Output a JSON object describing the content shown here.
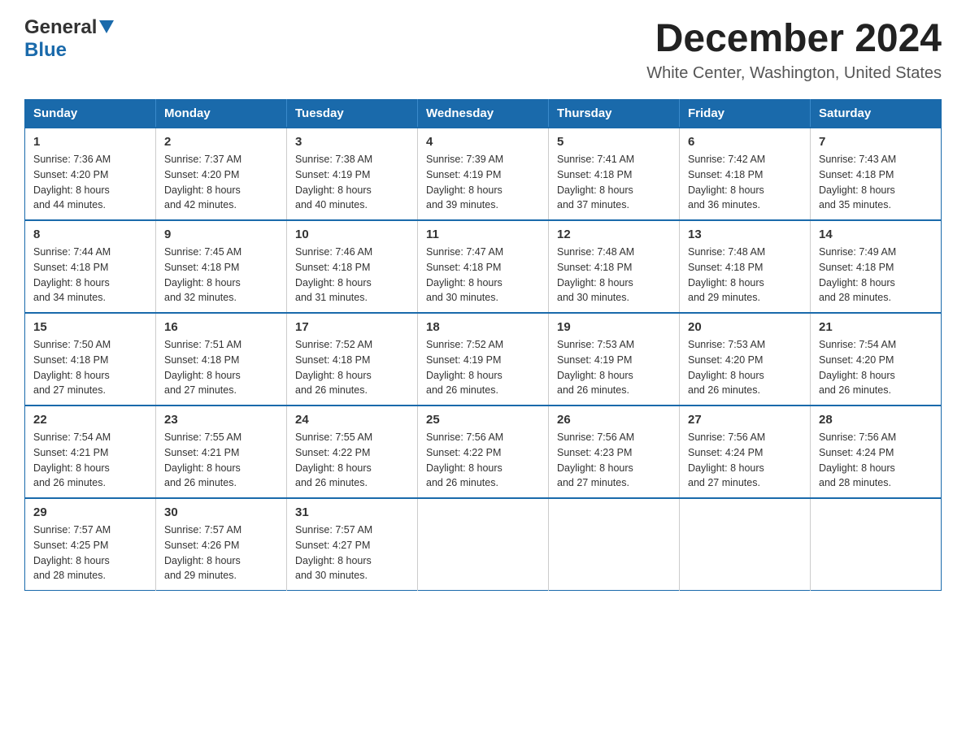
{
  "header": {
    "logo_general": "General",
    "logo_blue": "Blue",
    "month_title": "December 2024",
    "location": "White Center, Washington, United States"
  },
  "days_of_week": [
    "Sunday",
    "Monday",
    "Tuesday",
    "Wednesday",
    "Thursday",
    "Friday",
    "Saturday"
  ],
  "weeks": [
    [
      {
        "day": "1",
        "sunrise": "7:36 AM",
        "sunset": "4:20 PM",
        "daylight": "8 hours and 44 minutes."
      },
      {
        "day": "2",
        "sunrise": "7:37 AM",
        "sunset": "4:20 PM",
        "daylight": "8 hours and 42 minutes."
      },
      {
        "day": "3",
        "sunrise": "7:38 AM",
        "sunset": "4:19 PM",
        "daylight": "8 hours and 40 minutes."
      },
      {
        "day": "4",
        "sunrise": "7:39 AM",
        "sunset": "4:19 PM",
        "daylight": "8 hours and 39 minutes."
      },
      {
        "day": "5",
        "sunrise": "7:41 AM",
        "sunset": "4:18 PM",
        "daylight": "8 hours and 37 minutes."
      },
      {
        "day": "6",
        "sunrise": "7:42 AM",
        "sunset": "4:18 PM",
        "daylight": "8 hours and 36 minutes."
      },
      {
        "day": "7",
        "sunrise": "7:43 AM",
        "sunset": "4:18 PM",
        "daylight": "8 hours and 35 minutes."
      }
    ],
    [
      {
        "day": "8",
        "sunrise": "7:44 AM",
        "sunset": "4:18 PM",
        "daylight": "8 hours and 34 minutes."
      },
      {
        "day": "9",
        "sunrise": "7:45 AM",
        "sunset": "4:18 PM",
        "daylight": "8 hours and 32 minutes."
      },
      {
        "day": "10",
        "sunrise": "7:46 AM",
        "sunset": "4:18 PM",
        "daylight": "8 hours and 31 minutes."
      },
      {
        "day": "11",
        "sunrise": "7:47 AM",
        "sunset": "4:18 PM",
        "daylight": "8 hours and 30 minutes."
      },
      {
        "day": "12",
        "sunrise": "7:48 AM",
        "sunset": "4:18 PM",
        "daylight": "8 hours and 30 minutes."
      },
      {
        "day": "13",
        "sunrise": "7:48 AM",
        "sunset": "4:18 PM",
        "daylight": "8 hours and 29 minutes."
      },
      {
        "day": "14",
        "sunrise": "7:49 AM",
        "sunset": "4:18 PM",
        "daylight": "8 hours and 28 minutes."
      }
    ],
    [
      {
        "day": "15",
        "sunrise": "7:50 AM",
        "sunset": "4:18 PM",
        "daylight": "8 hours and 27 minutes."
      },
      {
        "day": "16",
        "sunrise": "7:51 AM",
        "sunset": "4:18 PM",
        "daylight": "8 hours and 27 minutes."
      },
      {
        "day": "17",
        "sunrise": "7:52 AM",
        "sunset": "4:18 PM",
        "daylight": "8 hours and 26 minutes."
      },
      {
        "day": "18",
        "sunrise": "7:52 AM",
        "sunset": "4:19 PM",
        "daylight": "8 hours and 26 minutes."
      },
      {
        "day": "19",
        "sunrise": "7:53 AM",
        "sunset": "4:19 PM",
        "daylight": "8 hours and 26 minutes."
      },
      {
        "day": "20",
        "sunrise": "7:53 AM",
        "sunset": "4:20 PM",
        "daylight": "8 hours and 26 minutes."
      },
      {
        "day": "21",
        "sunrise": "7:54 AM",
        "sunset": "4:20 PM",
        "daylight": "8 hours and 26 minutes."
      }
    ],
    [
      {
        "day": "22",
        "sunrise": "7:54 AM",
        "sunset": "4:21 PM",
        "daylight": "8 hours and 26 minutes."
      },
      {
        "day": "23",
        "sunrise": "7:55 AM",
        "sunset": "4:21 PM",
        "daylight": "8 hours and 26 minutes."
      },
      {
        "day": "24",
        "sunrise": "7:55 AM",
        "sunset": "4:22 PM",
        "daylight": "8 hours and 26 minutes."
      },
      {
        "day": "25",
        "sunrise": "7:56 AM",
        "sunset": "4:22 PM",
        "daylight": "8 hours and 26 minutes."
      },
      {
        "day": "26",
        "sunrise": "7:56 AM",
        "sunset": "4:23 PM",
        "daylight": "8 hours and 27 minutes."
      },
      {
        "day": "27",
        "sunrise": "7:56 AM",
        "sunset": "4:24 PM",
        "daylight": "8 hours and 27 minutes."
      },
      {
        "day": "28",
        "sunrise": "7:56 AM",
        "sunset": "4:24 PM",
        "daylight": "8 hours and 28 minutes."
      }
    ],
    [
      {
        "day": "29",
        "sunrise": "7:57 AM",
        "sunset": "4:25 PM",
        "daylight": "8 hours and 28 minutes."
      },
      {
        "day": "30",
        "sunrise": "7:57 AM",
        "sunset": "4:26 PM",
        "daylight": "8 hours and 29 minutes."
      },
      {
        "day": "31",
        "sunrise": "7:57 AM",
        "sunset": "4:27 PM",
        "daylight": "8 hours and 30 minutes."
      },
      null,
      null,
      null,
      null
    ]
  ],
  "labels": {
    "sunrise": "Sunrise:",
    "sunset": "Sunset:",
    "daylight": "Daylight:"
  }
}
